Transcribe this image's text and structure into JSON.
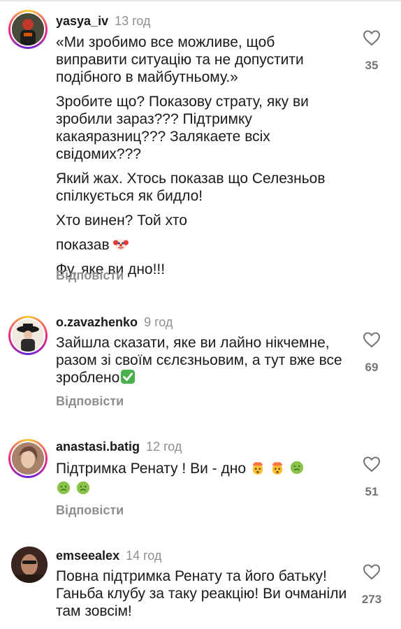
{
  "comments": [
    {
      "username": "yasya_iv",
      "time": "13 год",
      "paragraphs": [
        "«Ми зробимо все можливе, щоб виправити ситуацію та не допустити подібного в майбутньому.»",
        "Зробите що? Показову страту, яку ви зробили зараз??? Підтримку какаяразниц??? Залякаете всіх свідомих???",
        "Який жах. Хтось показав що Селезньов спілкується як бидло!",
        "Хто винен? Той хто",
        "показав",
        "Фу, яке ви дно!!!"
      ],
      "likes": "35",
      "reply": "Відповісти"
    },
    {
      "username": "o.zavazhenko",
      "time": "9 год",
      "text": "Зайшла сказати, яке ви лайно нікчемне, разом зі своїм сєлєзньовим, а тут вже все зроблено",
      "likes": "69",
      "reply": "Відповісти"
    },
    {
      "username": "anastasi.batig",
      "time": "12 год",
      "text": "Підтримка Ренату ! Ви - дно",
      "likes": "51",
      "reply": "Відповісти"
    },
    {
      "username": "emseealex",
      "time": "14 год",
      "text": "Повна підтримка Ренату та його батьку! Ганьба клубу за таку реакцію! Ви очманіли там зовсім!",
      "likes": "273"
    }
  ],
  "icons": {
    "like": "heart-outline-icon",
    "clown": "clown-face-emoji",
    "check": "check-mark-button-emoji",
    "exploding": "exploding-head-emoji",
    "nauseated": "nauseated-face-emoji"
  },
  "colors": {
    "username": "#1a1a1a",
    "muted": "#8e8e8e",
    "ring_start": "#f9ce34",
    "ring_mid": "#ee2a7b",
    "ring_end": "#6228d7"
  }
}
